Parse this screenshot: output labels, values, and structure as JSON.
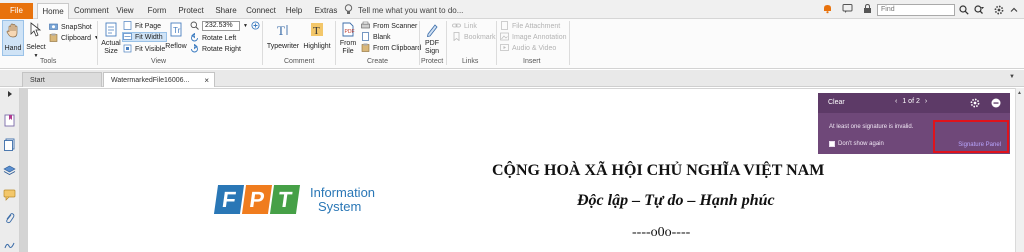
{
  "menubar": {
    "file_label": "File",
    "tabs": [
      "Home",
      "Comment",
      "View",
      "Form",
      "Protect",
      "Share",
      "Connect",
      "Help",
      "Extras"
    ],
    "tell_me": "Tell me what you want to do...",
    "find_placeholder": "Find"
  },
  "ribbon": {
    "tools": {
      "hand": "Hand",
      "select": "Select",
      "snapshot": "SnapShot",
      "clipboard": "Clipboard",
      "group": "Tools"
    },
    "view": {
      "actual_size": "Actual Size",
      "fit_page": "Fit Page",
      "fit_width": "Fit Width",
      "fit_visible": "Fit Visible",
      "reflow": "Reflow",
      "zoom": "232.53%",
      "rotate_left": "Rotate Left",
      "rotate_right": "Rotate Right",
      "group": "View"
    },
    "comment": {
      "typewriter": "Typewriter",
      "highlight": "Highlight",
      "group": "Comment"
    },
    "create": {
      "from_file": "From File",
      "from_scanner": "From Scanner",
      "blank": "Blank",
      "from_clipboard": "From Clipboard",
      "group": "Create"
    },
    "protect": {
      "pdf_sign": "PDF Sign",
      "group": "Protect"
    },
    "links": {
      "link": "Link",
      "bookmark": "Bookmark",
      "group": "Links"
    },
    "insert": {
      "file_attachment": "File Attachment",
      "image_annotation": "Image Annotation",
      "audio_video": "Audio & Video",
      "group": "Insert"
    }
  },
  "doc_tabs": [
    "Start",
    "WatermarkedFile16006..."
  ],
  "notification": {
    "clear": "Clear",
    "pager": "1 of 2",
    "message": "At least one signature is invalid.",
    "dont_show": "Don't show again",
    "link": "Signature Panel"
  },
  "document": {
    "title": "CỘNG HOÀ XÃ HỘI CHỦ NGHĨA VIỆT NAM",
    "subtitle": "Độc lập – Tự do – Hạnh phúc",
    "separator": "----o0o----",
    "logo_letters": [
      "F",
      "P",
      "T"
    ],
    "logo_text_line1": "Information",
    "logo_text_line2": "System"
  },
  "colors": {
    "file_tab": "#e8720c",
    "notification_bg": "#6f4879",
    "highlight_box": "#e0131c",
    "logo_blue": "#2a77b6",
    "logo_orange": "#f07c1e",
    "logo_green": "#46a047"
  }
}
